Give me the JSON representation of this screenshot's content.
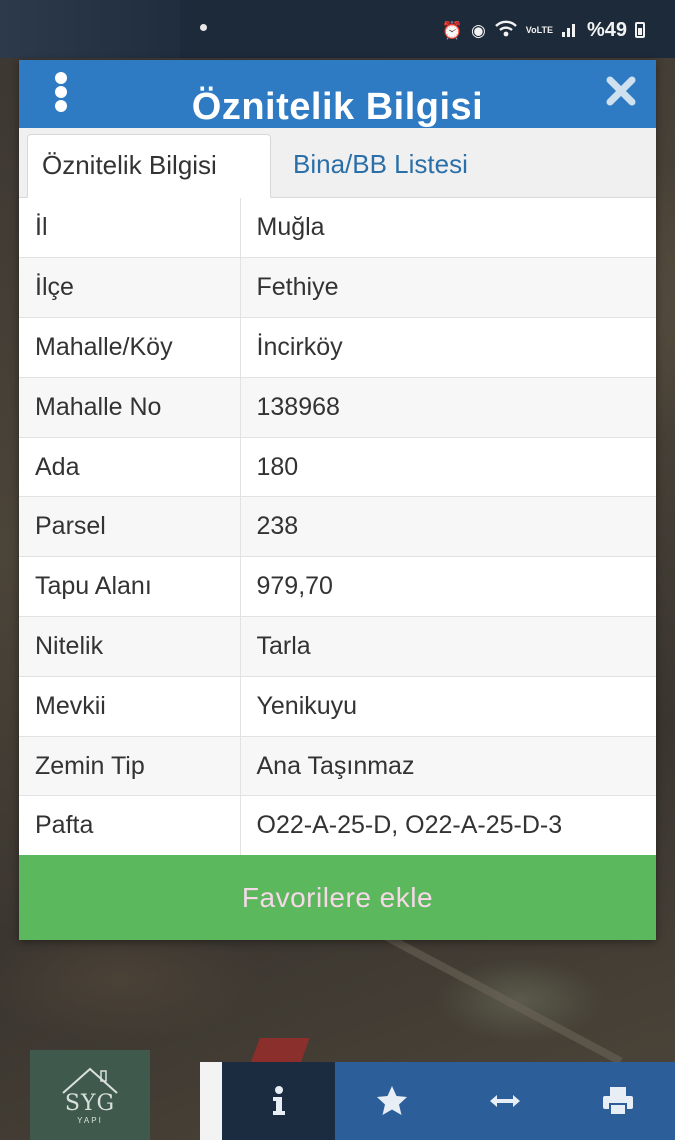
{
  "status_bar": {
    "battery_text": "%49",
    "icons": [
      "alarm-icon",
      "clock-icon",
      "wifi-icon",
      "volte-icon",
      "signal-icon",
      "battery-icon"
    ],
    "volte_label": "VoLTE"
  },
  "dialog": {
    "title": "Öznitelik Bilgisi",
    "tabs": [
      {
        "label": "Öznitelik Bilgisi",
        "active": true
      },
      {
        "label": "Bina/BB Listesi",
        "active": false
      }
    ],
    "rows": [
      {
        "key": "İl",
        "value": "Muğla"
      },
      {
        "key": "İlçe",
        "value": "Fethiye"
      },
      {
        "key": "Mahalle/Köy",
        "value": "İncirköy"
      },
      {
        "key": "Mahalle No",
        "value": "138968"
      },
      {
        "key": "Ada",
        "value": "180"
      },
      {
        "key": "Parsel",
        "value": "238"
      },
      {
        "key": "Tapu Alanı",
        "value": "979,70"
      },
      {
        "key": "Nitelik",
        "value": "Tarla"
      },
      {
        "key": "Mevkii",
        "value": "Yenikuyu"
      },
      {
        "key": "Zemin Tip",
        "value": "Ana Taşınmaz"
      },
      {
        "key": "Pafta",
        "value": "O22-A-25-D, O22-A-25-D-3"
      }
    ],
    "favorite_button": "Favorilere ekle"
  },
  "logo": {
    "brand": "SYG",
    "sub": "YAPI"
  },
  "bottom_nav": [
    {
      "icon": "info-icon",
      "active": true
    },
    {
      "icon": "star-icon",
      "active": false
    },
    {
      "icon": "measure-arrows-icon",
      "active": false
    },
    {
      "icon": "printer-icon",
      "active": false
    }
  ],
  "colors": {
    "header": "#2e7bc4",
    "favorite_button": "#5cb85c",
    "nav": "#2c5f9a",
    "nav_active": "#1b2b40"
  }
}
